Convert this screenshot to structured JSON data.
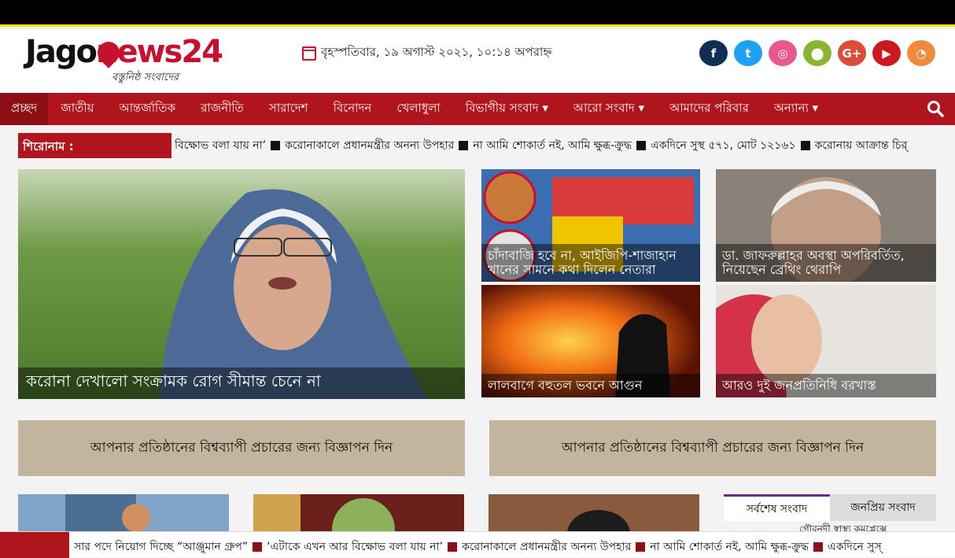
{
  "site": {
    "logo_word": "Jago",
    "logo_suffix": "news24",
    "tagline": "বস্তুনিষ্ঠ সংবাদের"
  },
  "header": {
    "date": "বৃহস্পতিবার, ১৯ অগাস্ট ২০২১, ১০:১৪ অপরাহ্ন"
  },
  "social": [
    {
      "name": "facebook-icon",
      "glyph": "f",
      "color": "#0f2e53"
    },
    {
      "name": "twitter-icon",
      "glyph": "t",
      "color": "#1da1f2"
    },
    {
      "name": "instagram-icon",
      "glyph": "◎",
      "color": "#e8598b"
    },
    {
      "name": "android-icon",
      "glyph": "⬤",
      "color": "#8ab530"
    },
    {
      "name": "google-plus-icon",
      "glyph": "G+",
      "color": "#dd4b39"
    },
    {
      "name": "youtube-icon",
      "glyph": "▶",
      "color": "#cc181e"
    },
    {
      "name": "rss-icon",
      "glyph": "◔",
      "color": "#f08a3a"
    }
  ],
  "nav": [
    {
      "label": "প্রচ্ছদ",
      "active": true
    },
    {
      "label": "জাতীয়"
    },
    {
      "label": "আন্তর্জাতিক"
    },
    {
      "label": "রাজনীতি"
    },
    {
      "label": "সারাদেশ"
    },
    {
      "label": "বিনোদন"
    },
    {
      "label": "খেলাধুলা"
    },
    {
      "label": "বিভাগীয় সংবাদ ▾"
    },
    {
      "label": "আরো সংবাদ ▾"
    },
    {
      "label": "আমাদের পরিবার"
    },
    {
      "label": "অন্যান্য ▾"
    }
  ],
  "ticker": {
    "label": "শিরোনাম :",
    "items": [
      "বিক্ষোভ বলা যায় না’",
      "করোনাকালে প্রধানমন্ত্রীর অনন্য উপহার",
      "না আমি শোকার্ত নই, আমি ক্ষুব্ধ-ক্রুদ্ধ",
      "একদিনে সুস্থ ৫৭১, মোট ১২১৬১",
      "করোনায় আক্রান্ত চির্"
    ]
  },
  "stories": {
    "main": "করোনা দেখালো সংক্রামক রোগ সীমান্ত চেনে না",
    "s1": "চাঁদাবাজি হবে না, আইজিপি-শাজাহান খানের সামনে কথা দিলেন নেতারা",
    "s2": "ডা. জাফরুল্লাহর অবস্থা অপরিবর্তিত, নিয়েছেন ব্রেথিং থেরাপি",
    "s3": "লালবাগে বহুতল ভবনে আগুন",
    "s4": "আরও দুই জনপ্রতিনিধি বরখাস্ত"
  },
  "ads": {
    "left": "আপনার প্রতিষ্ঠানের বিশ্বব্যাপী প্রচারের জন্য বিজ্ঞাপন দিন",
    "right": "আপনার প্রতিষ্ঠানের বিশ্বব্যাপী প্রচারের জন্য বিজ্ঞাপন দিন"
  },
  "tabs": {
    "latest": "সর্বশেষ সংবাদ",
    "popular": "জনপ্রিয় সংবাদ",
    "first_item": "গৌরনদী স্বাস্থ্য কমপ্লেক্সে"
  },
  "bottom_ticker": {
    "items": [
      "সার পদে নিয়োগ দিচ্ছে “আঞ্জুমান গ্রুপ”",
      "‘এটাকে এখন আর বিক্ষোভ বলা যায় না’",
      "করোনাকালে প্রধানমন্ত্রীর অনন্য উপহার",
      "না আমি শোকার্ত নই, আমি ক্ষুব্ধ-ক্রুদ্ধ",
      "একদিনে সুস্"
    ]
  }
}
